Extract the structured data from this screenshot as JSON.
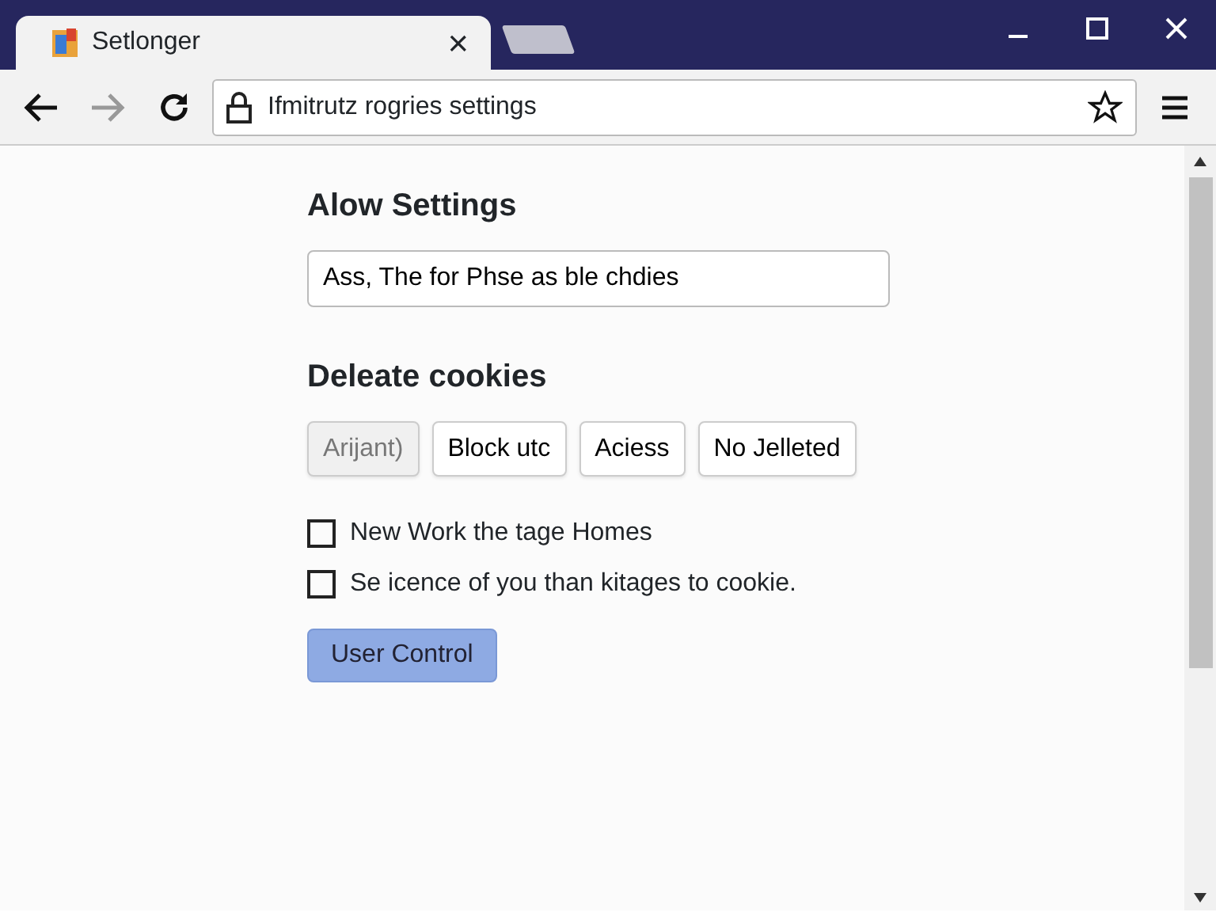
{
  "window": {
    "tabs": [
      {
        "title": "Setlonger",
        "selected": true,
        "close": "×"
      },
      {
        "selected": false
      }
    ]
  },
  "toolbar": {
    "address": "Ifmitrutz rogries settings"
  },
  "page": {
    "heading": "Alow Settings",
    "field": {
      "value": "Ass, The for Phse as ble chdies"
    },
    "section": "Deleate cookies",
    "options": [
      {
        "label": "Arijant)",
        "selected": true
      },
      {
        "label": "Block utc",
        "selected": false
      },
      {
        "label": "Aciess",
        "selected": false
      },
      {
        "label": "No Jelleted",
        "selected": false
      }
    ],
    "checkboxes": [
      {
        "label": "New Work the tage Homes",
        "checked": false
      },
      {
        "label": "Se icence of you than kitages to cookie.",
        "checked": false
      }
    ],
    "button": "User Control"
  }
}
